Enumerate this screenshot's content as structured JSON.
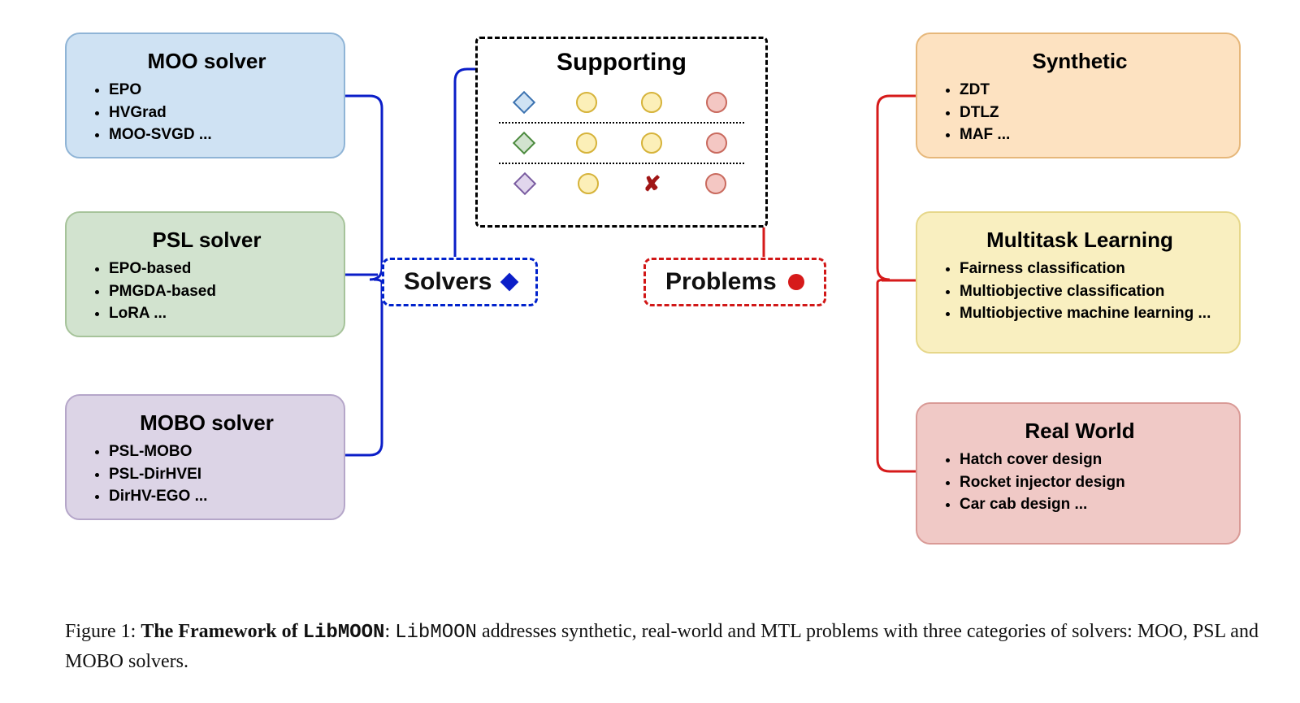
{
  "solvers": {
    "moo": {
      "title": "MOO solver",
      "items": [
        "EPO",
        "HVGrad",
        "MOO-SVGD ..."
      ]
    },
    "psl": {
      "title": "PSL solver",
      "items": [
        "EPO-based",
        "PMGDA-based",
        "LoRA ..."
      ]
    },
    "mobo": {
      "title": "MOBO solver",
      "items": [
        "PSL-MOBO",
        "PSL-DirHVEI",
        "DirHV-EGO ..."
      ]
    }
  },
  "problems": {
    "synthetic": {
      "title": "Synthetic",
      "items": [
        "ZDT",
        "DTLZ",
        "MAF ..."
      ]
    },
    "mtl": {
      "title": "Multitask Learning",
      "items": [
        "Fairness classification",
        "Multiobjective classification",
        "Multiobjective machine learning ..."
      ]
    },
    "realworld": {
      "title": "Real World",
      "items": [
        "Hatch cover design",
        "Rocket injector design",
        "Car cab design ..."
      ]
    }
  },
  "center": {
    "supporting_label": "Supporting",
    "solvers_label": "Solvers",
    "problems_label": "Problems"
  },
  "support_grid": {
    "rows": [
      {
        "solver_shape": "diamond-blue",
        "cells": [
          "circle-yellow",
          "circle-yellow",
          "circle-red"
        ]
      },
      {
        "solver_shape": "diamond-green",
        "cells": [
          "circle-yellow",
          "circle-yellow",
          "circle-red"
        ]
      },
      {
        "solver_shape": "diamond-purple",
        "cells": [
          "circle-yellow",
          "cross-red",
          "circle-red"
        ]
      }
    ]
  },
  "caption": {
    "prefix": "Figure 1: ",
    "bold": "The Framework of ",
    "lib": "LibMOON",
    "sep": ": ",
    "rest": " addresses synthetic, real-world and MTL problems with three categories of solvers: MOO, PSL and MOBO solvers."
  }
}
